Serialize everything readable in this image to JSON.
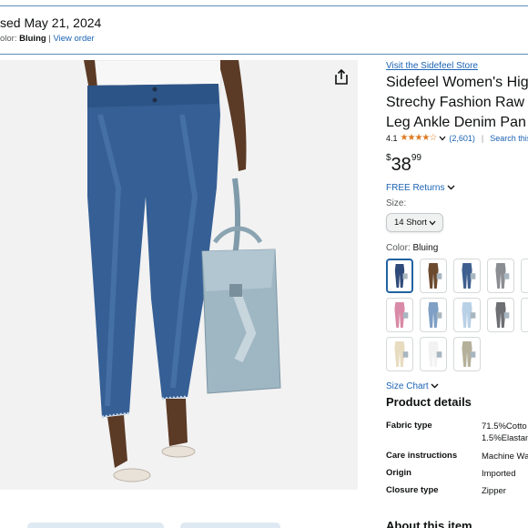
{
  "order": {
    "date_text": "sed May 21, 2024",
    "color_prefix": "olor: ",
    "color_value": "Bluing",
    "separator": " | ",
    "view_order_link": "View order"
  },
  "product": {
    "store_link": "Visit the Sidefeel Store",
    "title_lines": [
      "Sidefeel Women's Hig",
      "Strechy Fashion Raw I",
      "Leg Ankle Denim Pan"
    ],
    "rating": "4.1",
    "rating_stars": "★★★★☆",
    "rating_count": "(2,601)",
    "search_link": "Search this pa",
    "price_symbol": "$",
    "price_whole": "38",
    "price_fraction": "99",
    "free_returns": "FREE Returns",
    "size_label": "Size:",
    "size_value": "14 Short",
    "color_label": "Color: ",
    "color_value": "Bluing",
    "size_chart_link": "Size Chart",
    "details_title": "Product details",
    "details": [
      {
        "key": "Fabric type",
        "value_lines": [
          "71.5%Cotto",
          "1.5%Elastan"
        ]
      },
      {
        "key": "Care instructions",
        "value_lines": [
          "Machine Wa"
        ]
      },
      {
        "key": "Origin",
        "value_lines": [
          "Imported"
        ]
      },
      {
        "key": "Closure type",
        "value_lines": [
          "Zipper"
        ]
      }
    ],
    "about_title": "About this item"
  },
  "swatches": [
    {
      "color": "#2e4a78",
      "selected": true
    },
    {
      "color": "#6b4a2e",
      "selected": false
    },
    {
      "color": "#3f5f8f",
      "selected": false
    },
    {
      "color": "#8a8d92",
      "selected": false
    },
    {
      "color": "#6e7378",
      "selected": false
    },
    {
      "color": "#d98aa6",
      "selected": false
    },
    {
      "color": "#7f9fc4",
      "selected": false
    },
    {
      "color": "#b9d1e6",
      "selected": false
    },
    {
      "color": "#6d6f72",
      "selected": false
    },
    {
      "color": "#a9c3da",
      "selected": false
    },
    {
      "color": "#e8dcc0",
      "selected": false
    },
    {
      "color": "#f2f2f2",
      "selected": false
    },
    {
      "color": "#b5b09a",
      "selected": false
    }
  ],
  "icons": {
    "share": "share-icon",
    "chevron": "chevron-down-icon"
  }
}
